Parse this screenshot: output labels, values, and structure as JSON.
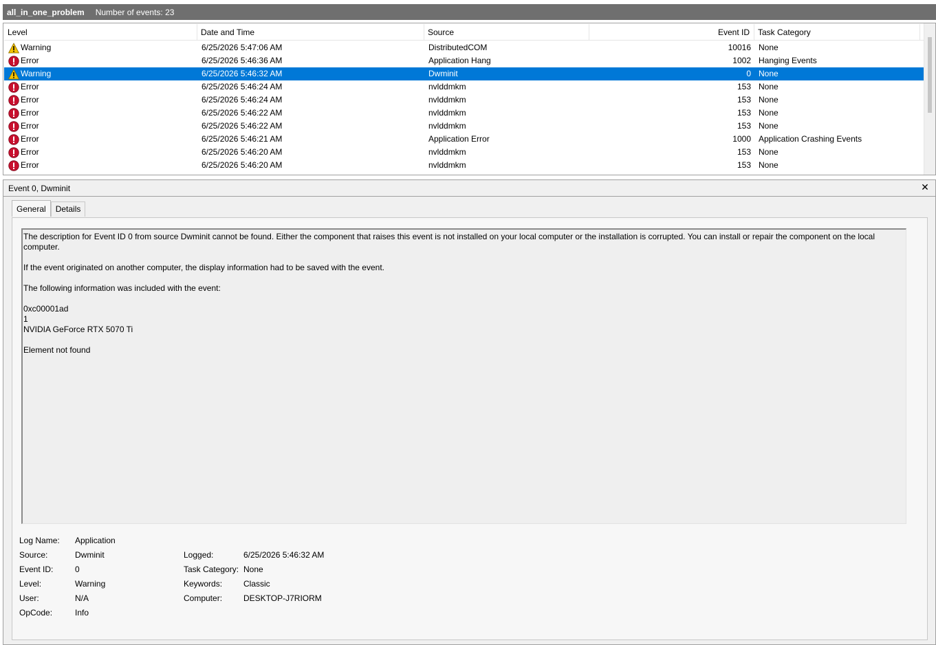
{
  "titlebar": {
    "log_name": "all_in_one_problem",
    "event_count": "Number of events: 23"
  },
  "list": {
    "columns": [
      "Level",
      "Date and Time",
      "Source",
      "Event ID",
      "Task Category"
    ],
    "rows": [
      {
        "level": "Warning",
        "icon": "warning-icon",
        "date": "6/25/2026 5:47:06 AM",
        "source": "DistributedCOM",
        "event_id": "10016",
        "category": "None"
      },
      {
        "level": "Error",
        "icon": "error-icon",
        "date": "6/25/2026 5:46:36 AM",
        "source": "Application Hang",
        "event_id": "1002",
        "category": "Hanging Events"
      },
      {
        "level": "Warning",
        "icon": "warning-icon",
        "date": "6/25/2026 5:46:32 AM",
        "source": "Dwminit",
        "event_id": "0",
        "category": "None",
        "selected": true
      },
      {
        "level": "Error",
        "icon": "error-icon",
        "date": "6/25/2026 5:46:24 AM",
        "source": "nvlddmkm",
        "event_id": "153",
        "category": "None"
      },
      {
        "level": "Error",
        "icon": "error-icon",
        "date": "6/25/2026 5:46:24 AM",
        "source": "nvlddmkm",
        "event_id": "153",
        "category": "None"
      },
      {
        "level": "Error",
        "icon": "error-icon",
        "date": "6/25/2026 5:46:22 AM",
        "source": "nvlddmkm",
        "event_id": "153",
        "category": "None"
      },
      {
        "level": "Error",
        "icon": "error-icon",
        "date": "6/25/2026 5:46:22 AM",
        "source": "nvlddmkm",
        "event_id": "153",
        "category": "None"
      },
      {
        "level": "Error",
        "icon": "error-icon",
        "date": "6/25/2026 5:46:21 AM",
        "source": "Application Error",
        "event_id": "1000",
        "category": "Application Crashing Events"
      },
      {
        "level": "Error",
        "icon": "error-icon",
        "date": "6/25/2026 5:46:20 AM",
        "source": "nvlddmkm",
        "event_id": "153",
        "category": "None"
      },
      {
        "level": "Error",
        "icon": "error-icon",
        "date": "6/25/2026 5:46:20 AM",
        "source": "nvlddmkm",
        "event_id": "153",
        "category": "None"
      }
    ]
  },
  "detail": {
    "title": "Event 0, Dwminit",
    "tabs": [
      "General",
      "Details"
    ],
    "description": [
      "The description for Event ID 0 from source Dwminit cannot be found. Either the component that raises this event is not installed on your local computer or the installation is corrupted. You can install or repair the component on the local computer.",
      "",
      "If the event originated on another computer, the display information had to be saved with the event.",
      "",
      "The following information was included with the event:",
      "",
      "0xc00001ad",
      "1",
      "NVIDIA GeForce RTX 5070 Ti",
      "",
      "Element not found"
    ],
    "properties": {
      "log_name_label": "Log Name:",
      "log_name": "Application",
      "source_label": "Source:",
      "source": "Dwminit",
      "event_id_label": "Event ID:",
      "event_id": "0",
      "level_label": "Level:",
      "level": "Warning",
      "user_label": "User:",
      "user": "N/A",
      "opcode_label": "OpCode:",
      "opcode": "Info",
      "logged_label": "Logged:",
      "logged": "6/25/2026 5:46:32 AM",
      "task_category_label": "Task Category:",
      "task_category": "None",
      "keywords_label": "Keywords:",
      "keywords": "Classic",
      "computer_label": "Computer:",
      "computer": "DESKTOP-J7RIORM"
    }
  },
  "colors": {
    "titlebar_bg": "#6f6f6f",
    "selection": "#0078d7",
    "error": "#c8102e",
    "warning": "#f4c200"
  }
}
